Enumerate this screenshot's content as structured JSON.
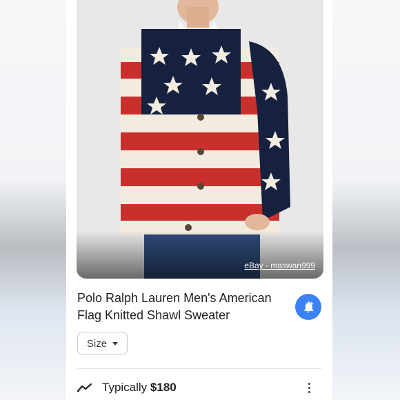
{
  "product": {
    "image_source": "eBay - maswan999",
    "title": "Polo Ralph Lauren Men's American Flag Knitted Shawl Sweater",
    "price_prefix": "Typically",
    "price": "$180"
  },
  "filters": {
    "size_label": "Size"
  },
  "icons": {
    "alert": "bell-plus-icon",
    "trend": "trend-line-icon",
    "more": "more-vert-icon",
    "dropdown": "chevron-down-icon"
  },
  "colors": {
    "accent": "#3b82f6",
    "flag_red": "#c9302c",
    "flag_navy": "#16213f",
    "flag_cream": "#f2ece0"
  }
}
